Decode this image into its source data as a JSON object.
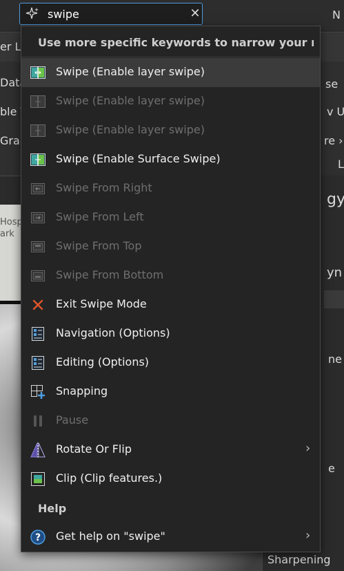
{
  "search": {
    "value": "swipe",
    "clear_glyph": "✕"
  },
  "background": {
    "ribbon_left_1": "er L",
    "ribbon_left_2": "Data",
    "ribbon_left_3": "ble T",
    "ribbon_left_4": "Grap",
    "ribbon_right_1": "se",
    "ribbon_right_2": "v U",
    "ribbon_right_3": "re ›",
    "ribbon_right_4": "L",
    "top_right": "N",
    "map_label_1": "Hosp",
    "map_label_2": "ark",
    "panel_1": "gy",
    "panel_2": "yn",
    "panel_3": "ne",
    "panel_4": "e",
    "panel_bottom": "Sharpening"
  },
  "dropdown": {
    "hint": "Use more specific keywords to narrow your resu",
    "items": [
      {
        "label": "Swipe (Enable layer swipe)",
        "icon": "layer-swipe-icon",
        "enabled": true,
        "selected": true
      },
      {
        "label": "Swipe (Enable layer swipe)",
        "icon": "layer-swipe-icon",
        "enabled": false
      },
      {
        "label": "Swipe (Enable layer swipe)",
        "icon": "layer-swipe-icon",
        "enabled": false
      },
      {
        "label": "Swipe (Enable Surface Swipe)",
        "icon": "surface-swipe-icon",
        "enabled": true
      },
      {
        "label": "Swipe From Right",
        "icon": "swipe-from-right-icon",
        "enabled": false
      },
      {
        "label": "Swipe From Left",
        "icon": "swipe-from-left-icon",
        "enabled": false
      },
      {
        "label": "Swipe From Top",
        "icon": "swipe-from-top-icon",
        "enabled": false
      },
      {
        "label": "Swipe From Bottom",
        "icon": "swipe-from-bottom-icon",
        "enabled": false
      },
      {
        "label": "Exit Swipe Mode",
        "icon": "exit-x-icon",
        "enabled": true
      },
      {
        "label": "Navigation (Options)",
        "icon": "options-list-icon",
        "enabled": true
      },
      {
        "label": "Editing (Options)",
        "icon": "options-list-icon",
        "enabled": true
      },
      {
        "label": "Snapping",
        "icon": "snapping-icon",
        "enabled": true
      },
      {
        "label": "Pause",
        "icon": "pause-icon",
        "enabled": false
      },
      {
        "label": "Rotate Or Flip",
        "icon": "rotate-flip-icon",
        "enabled": true,
        "submenu": true
      },
      {
        "label": "Clip (Clip features.)",
        "icon": "clip-icon",
        "enabled": true
      }
    ],
    "help_heading": "Help",
    "help_item": {
      "label": "Get help on  \"swipe\"",
      "icon": "help-icon",
      "submenu": true
    }
  },
  "colors": {
    "accent": "#4d9de0",
    "exit_red": "#e0552b",
    "swipe_teal": "#3fa6a0",
    "swipe_green": "#6cc24a"
  }
}
